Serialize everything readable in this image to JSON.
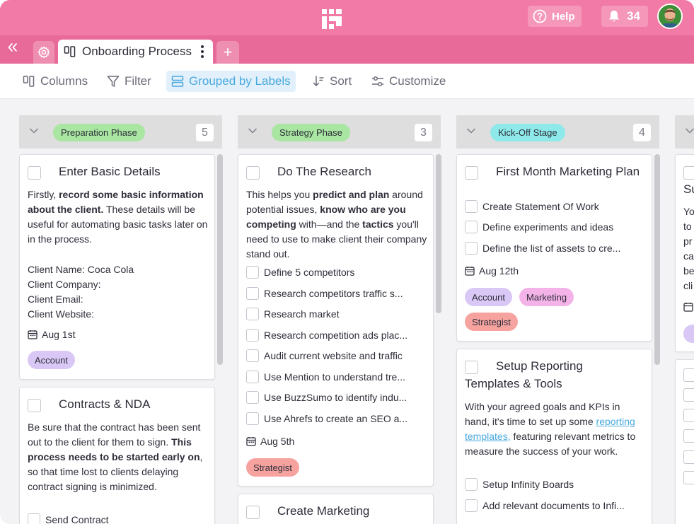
{
  "topbar": {
    "help_label": "Help",
    "notification_count": "34",
    "colors": {
      "topbar": "#f27aa6",
      "tabbar": "#e86a98"
    }
  },
  "tabs": {
    "active_title": "Onboarding Process",
    "add_label": "+"
  },
  "toolbar": {
    "columns": "Columns",
    "filter": "Filter",
    "grouped": "Grouped by Labels",
    "sort": "Sort",
    "customize": "Customize"
  },
  "columns": [
    {
      "label": "Preparation Phase",
      "label_color": "#a8e6a1",
      "count": "5",
      "cards": [
        {
          "title": "Enter Basic Details",
          "desc": [
            {
              "t": "Firstly, "
            },
            {
              "t": "record some basic information about the client.",
              "b": true
            },
            {
              "t": " These details will be useful for automating basic tasks later on in the process."
            }
          ],
          "fields": [
            "Client Name: Coca Cola",
            "Client Company:",
            "Client Email:",
            "Client Website:"
          ],
          "date": "Aug 1st",
          "tags": [
            {
              "name": "Account",
              "color": "#d9c8f5"
            }
          ]
        },
        {
          "title": "Contracts & NDA",
          "desc": [
            {
              "t": "Be sure that the contract has been sent out to the client for them to sign. "
            },
            {
              "t": "This process needs to be started early on",
              "b": true
            },
            {
              "t": ", so that time lost to clients delaying contract signing is minimized."
            }
          ],
          "checklist": [
            "Send Contract"
          ]
        }
      ]
    },
    {
      "label": "Strategy Phase",
      "label_color": "#a8e6a1",
      "count": "3",
      "cards": [
        {
          "title": "Do The Research",
          "desc": [
            {
              "t": "This helps you "
            },
            {
              "t": "predict and plan",
              "b": true
            },
            {
              "t": " around potential issues, "
            },
            {
              "t": "know who are you competing",
              "b": true
            },
            {
              "t": " with—and the "
            },
            {
              "t": "tactics",
              "b": true
            },
            {
              "t": " you'll need to use to make client their company stand out."
            }
          ],
          "checklist": [
            "Define 5 competitors",
            "Research competitors traffic s...",
            "Research market",
            "Research competition ads plac...",
            "Audit current website and traffic",
            "Use Mention to understand tre...",
            "Use BuzzSumo to identify indu...",
            "Use Ahrefs to create an SEO a..."
          ],
          "date": "Aug 5th",
          "tags": [
            {
              "name": "Strategist",
              "color": "#f6a3a0"
            }
          ]
        },
        {
          "title": "Create Marketing"
        }
      ]
    },
    {
      "label": "Kick-Off Stage",
      "label_color": "#8eeaea",
      "count": "4",
      "cards": [
        {
          "title": "First Month Marketing Plan",
          "checklist": [
            "Create Statement Of Work",
            "Define experiments and ideas",
            "Define the list of assets to cre..."
          ],
          "date": "Aug 12th",
          "tags": [
            {
              "name": "Account",
              "color": "#d9c8f5"
            },
            {
              "name": "Marketing",
              "color": "#f4b3e8"
            },
            {
              "name": "Strategist",
              "color": "#f6a3a0"
            }
          ]
        },
        {
          "title": "Setup Reporting Templates & Tools",
          "desc": [
            {
              "t": "With your agreed goals and KPIs in hand, it's time to set up some "
            },
            {
              "t": "reporting templates,",
              "link": true
            },
            {
              "t": " featuring relevant metrics to measure the success of your work."
            }
          ],
          "checklist": [
            "Setup Infinity Boards",
            "Add relevant documents to Infi..."
          ]
        }
      ]
    },
    {
      "partial_title": "Su",
      "partial_lines": [
        "Yo",
        "to",
        "pr",
        "ca",
        "be",
        "cli"
      ]
    }
  ]
}
